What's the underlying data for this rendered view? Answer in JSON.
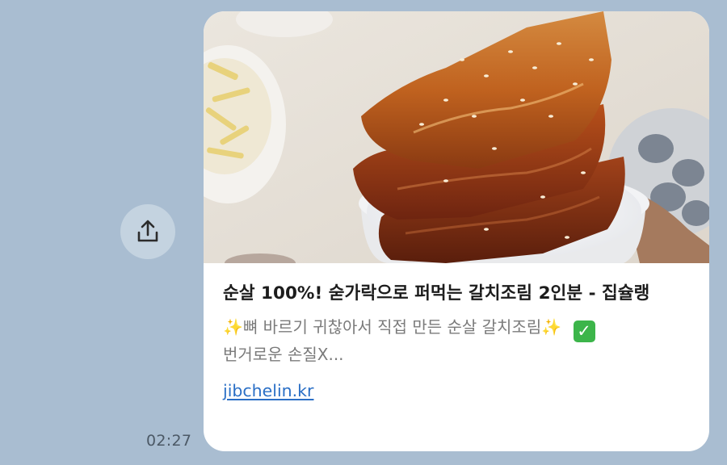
{
  "message": {
    "time": "02:27",
    "share_icon": "share-upload-icon",
    "link_card": {
      "image_alt": "양념 갈치조림을 쌓아 올린 밥 그릇",
      "title": "순살 100%! 숟가락으로 퍼먹는 갈치조림 2인분 - 집슐랭",
      "desc_text": "✨뼈 바르기 귀찮아서 직접 만든 순살 갈치조림✨ ",
      "desc_check": "✓",
      "desc_cont": "번거로운 손질X...",
      "url": "jibchelin.kr"
    }
  },
  "colors": {
    "chat_background": "#a9bdd1",
    "card_background": "#ffffff",
    "link": "#2a6fc6",
    "check_badge": "#3cb54a"
  }
}
